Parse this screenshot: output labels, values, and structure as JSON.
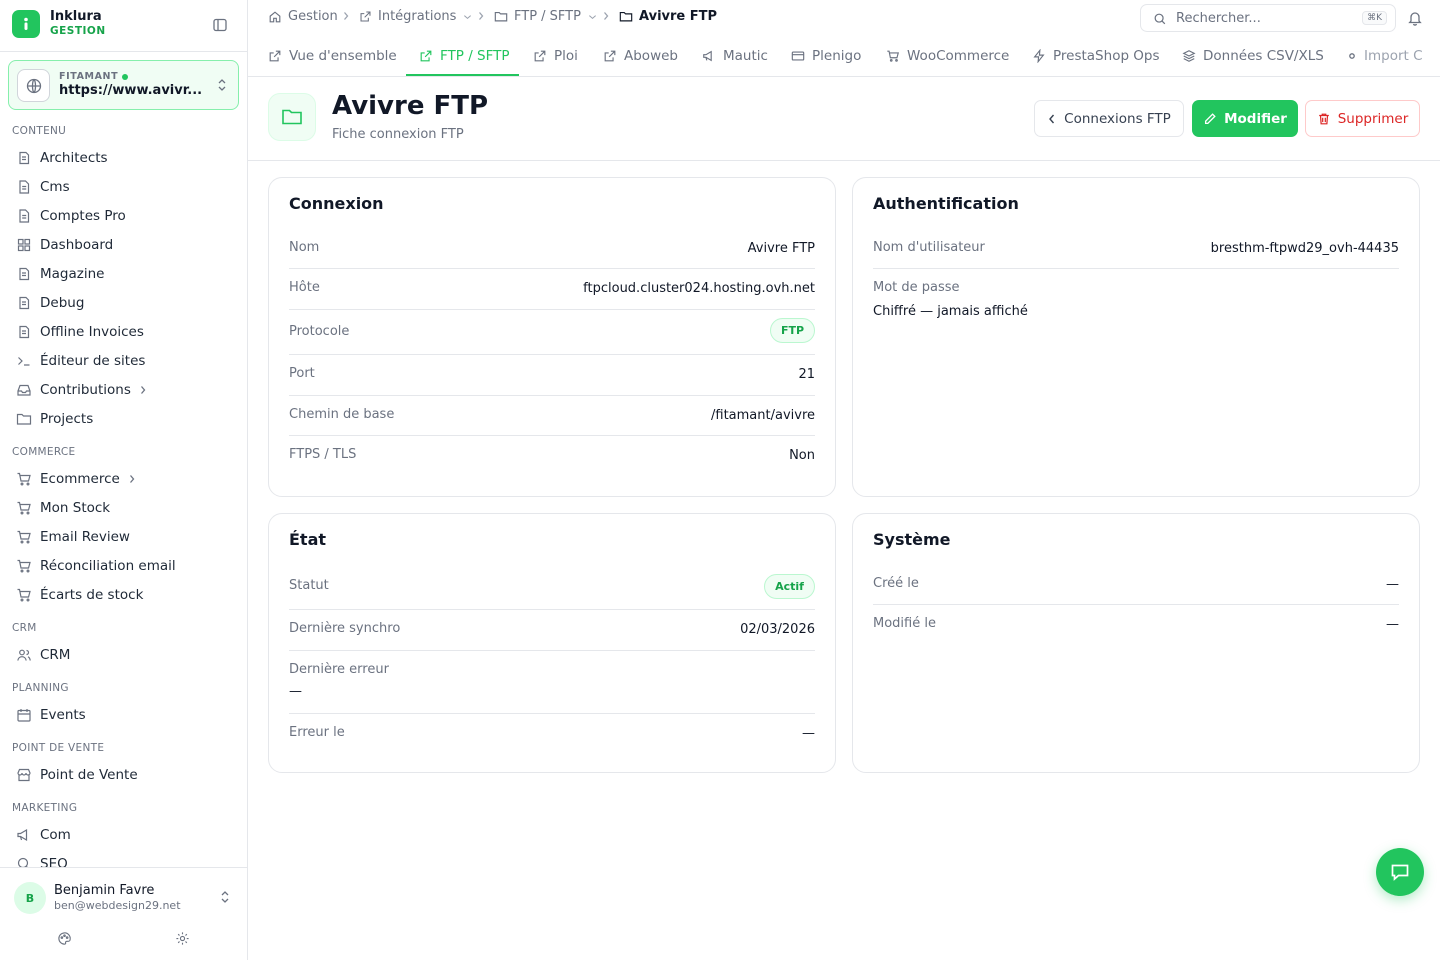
{
  "brand": {
    "name": "Inklura",
    "sub": "GESTION"
  },
  "site": {
    "label": "FITAMANT",
    "url": "https://www.avivr..."
  },
  "sidebar": {
    "sections": {
      "contenu": "CONTENU",
      "commerce": "COMMERCE",
      "crm": "CRM",
      "planning": "PLANNING",
      "pdv": "POINT DE VENTE",
      "marketing": "MARKETING"
    },
    "items": [
      {
        "label": "Architects",
        "icon": "file-stack-icon"
      },
      {
        "label": "Cms",
        "icon": "file-icon"
      },
      {
        "label": "Comptes Pro",
        "icon": "file-icon"
      },
      {
        "label": "Dashboard",
        "icon": "grid-icon"
      },
      {
        "label": "Magazine",
        "icon": "file-stack-icon"
      },
      {
        "label": "Debug",
        "icon": "file-stack-icon"
      },
      {
        "label": "Offline Invoices",
        "icon": "file-stack-icon"
      },
      {
        "label": "Éditeur de sites",
        "icon": "terminal-icon"
      },
      {
        "label": "Contributions",
        "icon": "inbox-icon"
      },
      {
        "label": "Projects",
        "icon": "folder-icon"
      },
      {
        "label": "Ecommerce",
        "icon": "cart-icon"
      },
      {
        "label": "Mon Stock",
        "icon": "cart-icon"
      },
      {
        "label": "Email Review",
        "icon": "cart-icon"
      },
      {
        "label": "Réconciliation email",
        "icon": "cart-icon"
      },
      {
        "label": "Écarts de stock",
        "icon": "cart-icon"
      },
      {
        "label": "CRM",
        "icon": "users-icon"
      },
      {
        "label": "Events",
        "icon": "calendar-icon"
      },
      {
        "label": "Point de Vente",
        "icon": "store-icon"
      },
      {
        "label": "Com",
        "icon": "megaphone-icon"
      },
      {
        "label": "SEO",
        "icon": "search-icon"
      }
    ]
  },
  "user": {
    "initial": "B",
    "name": "Benjamin Favre",
    "email": "ben@webdesign29.net"
  },
  "breadcrumb": {
    "home": "Gestion",
    "integrations": "Intégrations",
    "ftp": "FTP / SFTP",
    "current": "Avivre FTP"
  },
  "search": {
    "placeholder": "Rechercher...",
    "shortcut": "⌘K"
  },
  "tabs": [
    "Vue d'ensemble",
    "FTP / SFTP",
    "Ploi",
    "Aboweb",
    "Mautic",
    "Plenigo",
    "WooCommerce",
    "PrestaShop Ops",
    "Données CSV/XLS",
    "Import C"
  ],
  "header": {
    "title": "Avivre FTP",
    "subtitle": "Fiche connexion FTP",
    "back_label": "Connexions FTP",
    "edit_label": "Modifier",
    "delete_label": "Supprimer"
  },
  "connexion": {
    "title": "Connexion",
    "nom_label": "Nom",
    "nom": "Avivre FTP",
    "hote_label": "Hôte",
    "hote": "ftpcloud.cluster024.hosting.ovh.net",
    "protocole_label": "Protocole",
    "protocole": "FTP",
    "port_label": "Port",
    "port": "21",
    "chemin_label": "Chemin de base",
    "chemin": "/fitamant/avivre",
    "ftps_label": "FTPS / TLS",
    "ftps": "Non"
  },
  "auth": {
    "title": "Authentification",
    "user_label": "Nom d'utilisateur",
    "user": "bresthm-ftpwd29_ovh-44435",
    "pass_label": "Mot de passe",
    "pass": "Chiffré — jamais affiché"
  },
  "etat": {
    "title": "État",
    "statut_label": "Statut",
    "statut": "Actif",
    "synchro_label": "Dernière synchro",
    "synchro": "02/03/2026",
    "erreur_label": "Dernière erreur",
    "erreur": "—",
    "erreur_le_label": "Erreur le",
    "erreur_le": "—"
  },
  "systeme": {
    "title": "Système",
    "cree_label": "Créé le",
    "cree": "—",
    "modifie_label": "Modifié le",
    "modifie": "—"
  },
  "colors": {
    "accent": "#22c55e",
    "danger": "#dc2626",
    "border": "#e5e7eb"
  }
}
